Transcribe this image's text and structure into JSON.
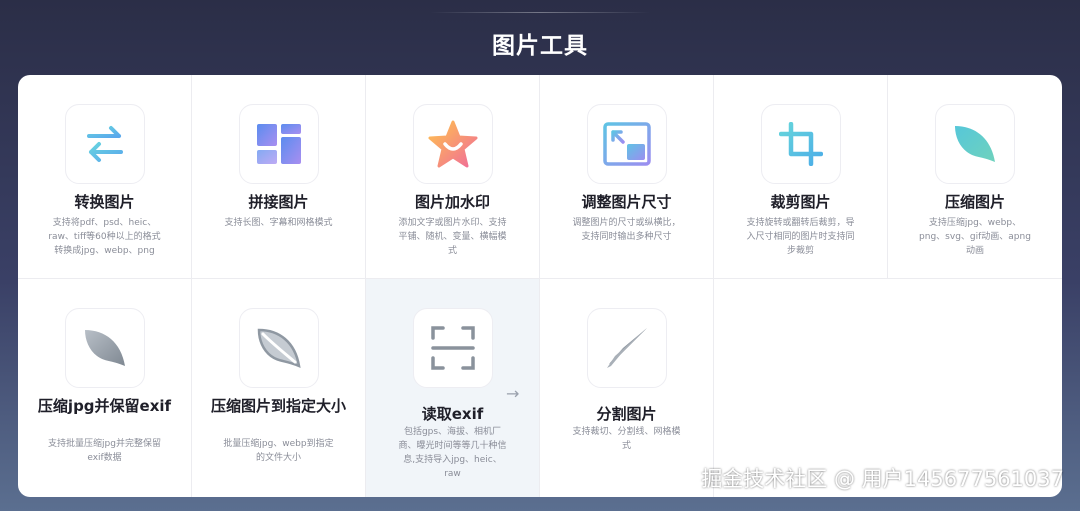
{
  "header": {
    "title": "图片工具"
  },
  "tools": [
    {
      "name": "转换图片",
      "desc": "支持将pdf、psd、heic、raw、tiff等60种以上的格式转换成jpg、webp、png",
      "icon": "convert-arrows-icon"
    },
    {
      "name": "拼接图片",
      "desc": "支持长图、字幕和网格模式",
      "icon": "grid-layout-icon"
    },
    {
      "name": "图片加水印",
      "desc": "添加文字或图片水印、支持平铺、随机、变量、横幅模式",
      "icon": "star-smile-icon"
    },
    {
      "name": "调整图片尺寸",
      "desc": "调整图片的尺寸或纵横比，支持同时输出多种尺寸",
      "icon": "resize-icon"
    },
    {
      "name": "裁剪图片",
      "desc": "支持旋转或翻转后裁剪，导入尺寸相同的图片时支持同步裁剪",
      "icon": "crop-icon"
    },
    {
      "name": "压缩图片",
      "desc": "支持压缩jpg、webp、png、svg、gif动画、apng动画",
      "icon": "leaf-icon"
    },
    {
      "name": "压缩jpg并保留exif",
      "desc": "支持批量压缩jpg并完整保留exif数据",
      "icon": "leaf-gray-icon"
    },
    {
      "name": "压缩图片到指定大小",
      "desc": "批量压缩jpg、webp到指定的文件大小",
      "icon": "leaf-outline-icon"
    },
    {
      "name": "读取exif",
      "desc": "包括gps、海拔、相机厂商、曝光时间等等几十种信息,支持导入jpg、heic、raw",
      "icon": "scan-icon"
    },
    {
      "name": "分割图片",
      "desc": "支持裁切、分割线、网格模式",
      "icon": "knife-icon"
    }
  ],
  "watermark": "掘金技术社区 @ 用户145677561037",
  "colors": {
    "accent_blue": "#5bb8e8",
    "accent_purple": "#9b8fe8",
    "panel_bg": "#ffffff",
    "active_bg": "#f1f5f9"
  }
}
